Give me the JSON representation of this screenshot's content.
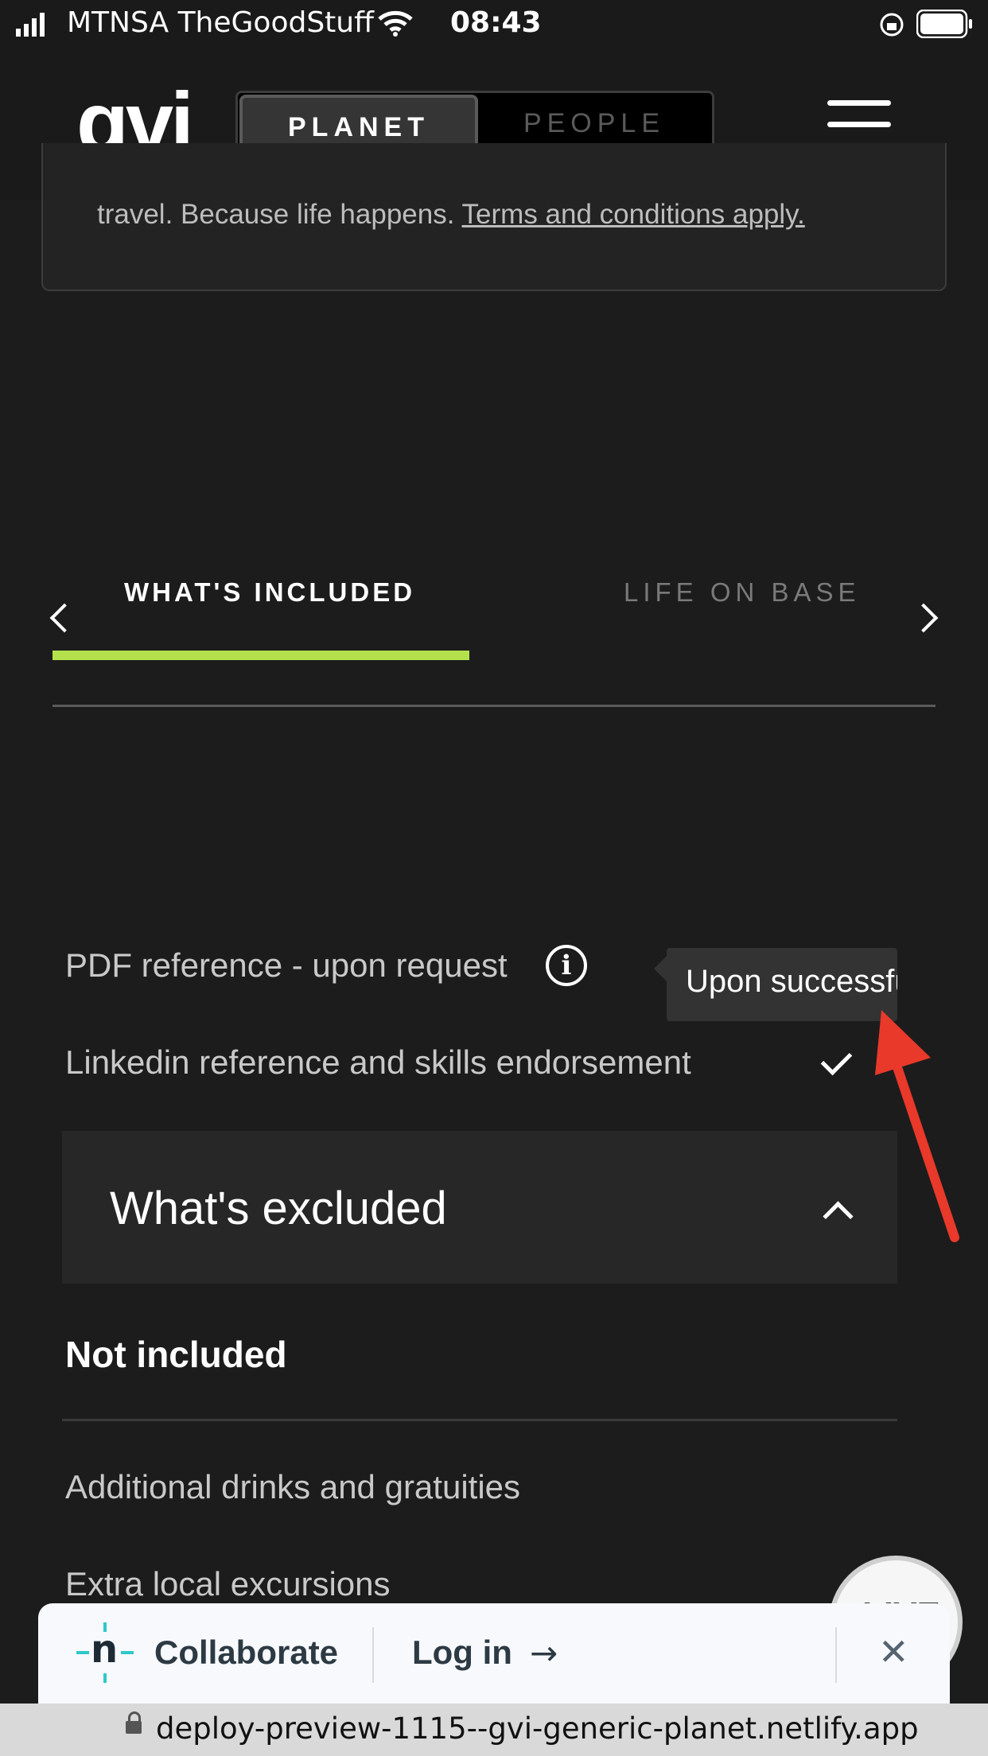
{
  "status_bar": {
    "carrier": "MTNSA TheGoodStuff",
    "time": "08:43"
  },
  "header": {
    "logo": "gvi",
    "toggle": {
      "planet": "PLANET",
      "people": "PEOPLE"
    }
  },
  "card": {
    "text": "travel. Because life happens. ",
    "link": "Terms and conditions apply."
  },
  "tabs": {
    "active": "WHAT'S INCLUDED",
    "inactive": "LIFE ON BASE"
  },
  "included": {
    "items": [
      {
        "label": "PDF reference - upon request"
      },
      {
        "label": "Linkedin reference and skills endorsement"
      }
    ],
    "tooltip": "Upon successful"
  },
  "excluded": {
    "title": "What's excluded",
    "subheading": "Not included",
    "items": [
      {
        "label": "Additional drinks and gratuities"
      },
      {
        "label": "Extra local excursions"
      }
    ]
  },
  "live_button": {
    "label": "LIVE"
  },
  "netlify_bar": {
    "collaborate": "Collaborate",
    "login": "Log in"
  },
  "url_bar": {
    "url": "deploy-preview-1115--gvi-generic-planet.netlify.app"
  },
  "colors": {
    "accent": "#b4e14b",
    "annotation": "#e8392a"
  }
}
